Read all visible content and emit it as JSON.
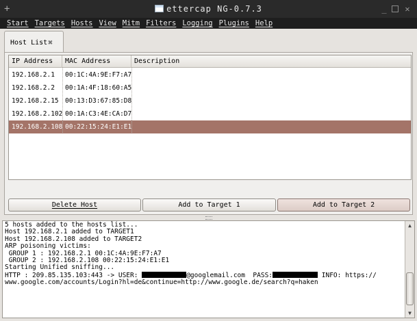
{
  "window": {
    "title": "ettercap NG-0.7.3"
  },
  "menubar": {
    "items": [
      "Start",
      "Targets",
      "Hosts",
      "View",
      "Mitm",
      "Filters",
      "Logging",
      "Plugins",
      "Help"
    ]
  },
  "tabs": [
    {
      "label": "Host List",
      "active": true
    }
  ],
  "host_table": {
    "columns": [
      "IP Address",
      "MAC Address",
      "Description"
    ],
    "rows": [
      {
        "ip": "192.168.2.1",
        "mac": "00:1C:4A:9E:F7:A7",
        "description": ""
      },
      {
        "ip": "192.168.2.2",
        "mac": "00:1A:4F:18:60:A5",
        "description": ""
      },
      {
        "ip": "192.168.2.15",
        "mac": "00:13:D3:67:85:D8",
        "description": ""
      },
      {
        "ip": "192.168.2.102",
        "mac": "00:1A:C3:4E:CA:D7",
        "description": ""
      },
      {
        "ip": "192.168.2.108",
        "mac": "00:22:15:24:E1:E1",
        "description": ""
      }
    ],
    "selected_row": 4
  },
  "buttons": {
    "delete_host": "Delete Host",
    "add_target_1": "Add to Target 1",
    "add_target_2": "Add to Target 2"
  },
  "log": {
    "line1": "5 hosts added to the hosts list...",
    "line2": "Host 192.168.2.1 added to TARGET1",
    "line3": "Host 192.168.2.108 added to TARGET2",
    "line4": "",
    "line5": "ARP poisoning victims:",
    "line6": "",
    "line7": " GROUP 1 : 192.168.2.1 00:1C:4A:9E:F7:A7",
    "line8": "",
    "line9": " GROUP 2 : 192.168.2.108 00:22:15:24:E1:E1",
    "line10": "Starting Unified sniffing...",
    "line11": "",
    "http_prefix": "HTTP : 209.85.135.103:443 -> USER: ",
    "http_user_suffix": "@googlemail.com  PASS:",
    "http_info": " INFO: https://",
    "line13": "www.google.com/accounts/Login?hl=de&continue=http://www.google.de/search?q=haken"
  },
  "colors": {
    "selected_row": "#a47468",
    "titlebar": "#2a2a2a",
    "menubar": "#1e1e1e"
  }
}
